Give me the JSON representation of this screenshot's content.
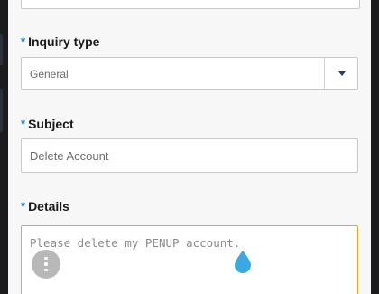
{
  "form": {
    "required_marker": "*",
    "inquiry_type": {
      "label": "Inquiry type",
      "value": "General"
    },
    "subject": {
      "label": "Subject",
      "value": "Delete Account"
    },
    "details": {
      "label": "Details",
      "value": "Please delete my PENUP account."
    }
  },
  "icons": {
    "dropdown": "chevron-down-icon",
    "more": "more-vertical-icon",
    "cursor": "text-cursor-handle-icon"
  },
  "colors": {
    "required_marker": "#1f7fd6",
    "focus_border": "#e0a93a",
    "cursor_handle": "#3aa9e0",
    "dropdown_arrow": "#2a3a6b"
  }
}
